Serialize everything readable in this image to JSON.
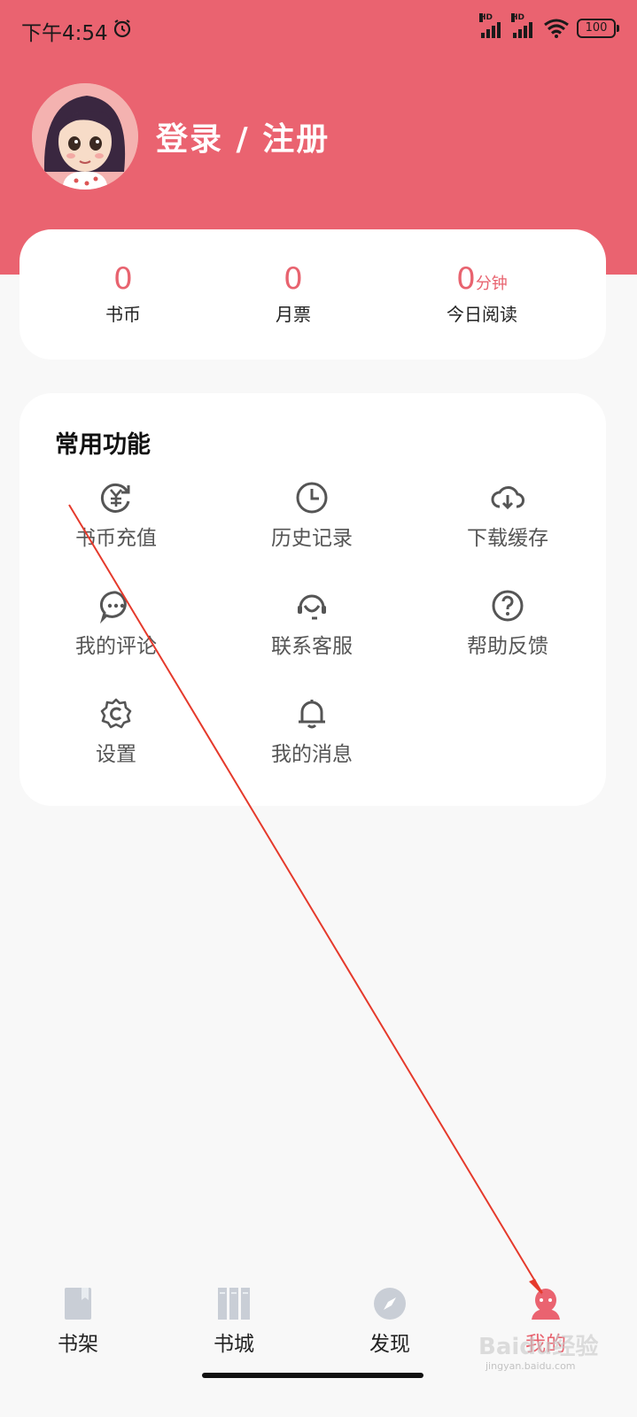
{
  "status_bar": {
    "time": "下午4:54",
    "battery": "100",
    "signal_label": "HD"
  },
  "profile": {
    "login_text": "登录 / 注册"
  },
  "stats": [
    {
      "value": "0",
      "unit": "",
      "label": "书币"
    },
    {
      "value": "0",
      "unit": "",
      "label": "月票"
    },
    {
      "value": "0",
      "unit": "分钟",
      "label": "今日阅读"
    }
  ],
  "functions": {
    "title": "常用功能",
    "items": [
      {
        "label": "书币充值",
        "icon": "coin-recharge-icon"
      },
      {
        "label": "历史记录",
        "icon": "clock-icon"
      },
      {
        "label": "下载缓存",
        "icon": "cloud-download-icon"
      },
      {
        "label": "我的评论",
        "icon": "comment-icon"
      },
      {
        "label": "联系客服",
        "icon": "headset-icon"
      },
      {
        "label": "帮助反馈",
        "icon": "help-icon"
      },
      {
        "label": "设置",
        "icon": "settings-icon"
      },
      {
        "label": "我的消息",
        "icon": "bell-icon"
      }
    ]
  },
  "tabbar": {
    "tabs": [
      {
        "label": "书架",
        "icon": "bookshelf-icon",
        "active": false
      },
      {
        "label": "书城",
        "icon": "bookstore-icon",
        "active": false
      },
      {
        "label": "发现",
        "icon": "compass-icon",
        "active": false
      },
      {
        "label": "我的",
        "icon": "profile-icon",
        "active": true
      }
    ]
  },
  "watermark": {
    "text": "Baidu经验",
    "sub": "jingyan.baidu.com"
  },
  "colors": {
    "accent": "#ea6370",
    "accent_text": "#e8636f",
    "background": "#f8f8f8",
    "card": "#ffffff",
    "annotation_arrow": "#e53a2c"
  }
}
